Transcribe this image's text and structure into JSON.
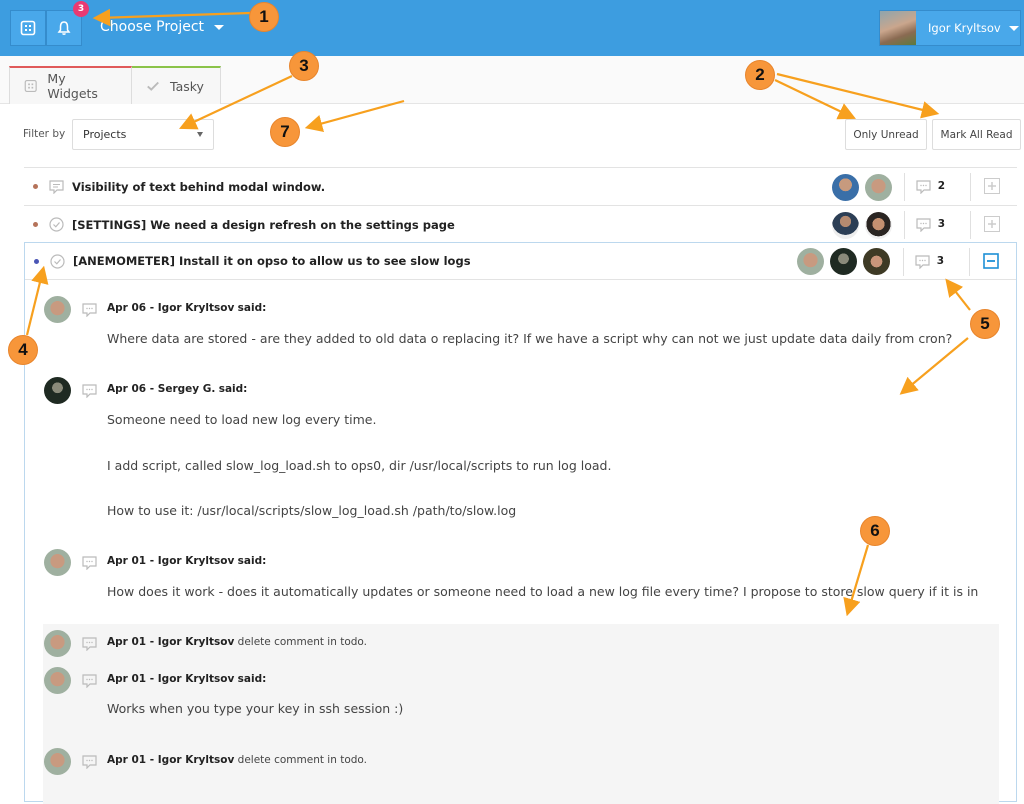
{
  "topbar": {
    "notifications_badge": "3",
    "project_selector": "Choose Project",
    "user_name": "Igor Kryltsov"
  },
  "tabs": [
    {
      "label": "My Widgets",
      "icon": "widgets-icon",
      "accent": "#e05a5a"
    },
    {
      "label": "Tasky",
      "icon": "check-icon",
      "accent": "#8bc34a"
    }
  ],
  "filter": {
    "label": "Filter by",
    "selected": "Projects"
  },
  "buttons": {
    "only_unread": "Only Unread",
    "mark_all_read": "Mark All Read"
  },
  "items": [
    {
      "title": "Visibility of text behind modal window.",
      "type_icon": "comment-icon",
      "dot_color": "#b5735a",
      "comments": "2",
      "participants": 2,
      "state": "collapsed"
    },
    {
      "title": "[SETTINGS] We need a design refresh on the settings page",
      "type_icon": "check-circle-icon",
      "dot_color": "#b5735a",
      "comments": "3",
      "participants": 2,
      "state": "collapsed"
    },
    {
      "title": "[ANEMOMETER] Install it on opso to allow us to see slow logs",
      "type_icon": "check-circle-icon",
      "dot_color": "#4a55b5",
      "comments": "3",
      "participants": 3,
      "state": "expanded"
    }
  ],
  "comments": [
    {
      "date": "Apr 06",
      "author": "Igor Kryltsov",
      "verb": "said:",
      "lines": [
        "Where data are stored - are they added to old data o replacing it? If we have a script why can not we just update data daily from cron?"
      ]
    },
    {
      "date": "Apr 06",
      "author": "Sergey G.",
      "verb": "said:",
      "lines": [
        "Someone need to load new log every time.",
        "I add script, called slow_log_load.sh to ops0, dir /usr/local/scripts to run log load.",
        "How to use it:  /usr/local/scripts/slow_log_load.sh /path/to/slow.log"
      ]
    },
    {
      "date": "Apr 01",
      "author": "Igor Kryltsov",
      "verb": "said:",
      "lines": [
        "How does it work - does it automatically updates or someone need to load a new log file every time? I propose to store slow query if it is in"
      ]
    },
    {
      "date": "Apr 01",
      "author": "Igor Kryltsov",
      "action": "delete comment in todo.",
      "lines": []
    },
    {
      "date": "Apr 01",
      "author": "Igor Kryltsov",
      "verb": "said:",
      "lines": [
        "Works when you type your key in ssh session :)"
      ]
    },
    {
      "date": "Apr 01",
      "author": "Igor Kryltsov",
      "action": "delete comment in todo.",
      "lines": []
    }
  ],
  "separator": " - ",
  "annotations": [
    "1",
    "2",
    "3",
    "4",
    "5",
    "6",
    "7"
  ]
}
